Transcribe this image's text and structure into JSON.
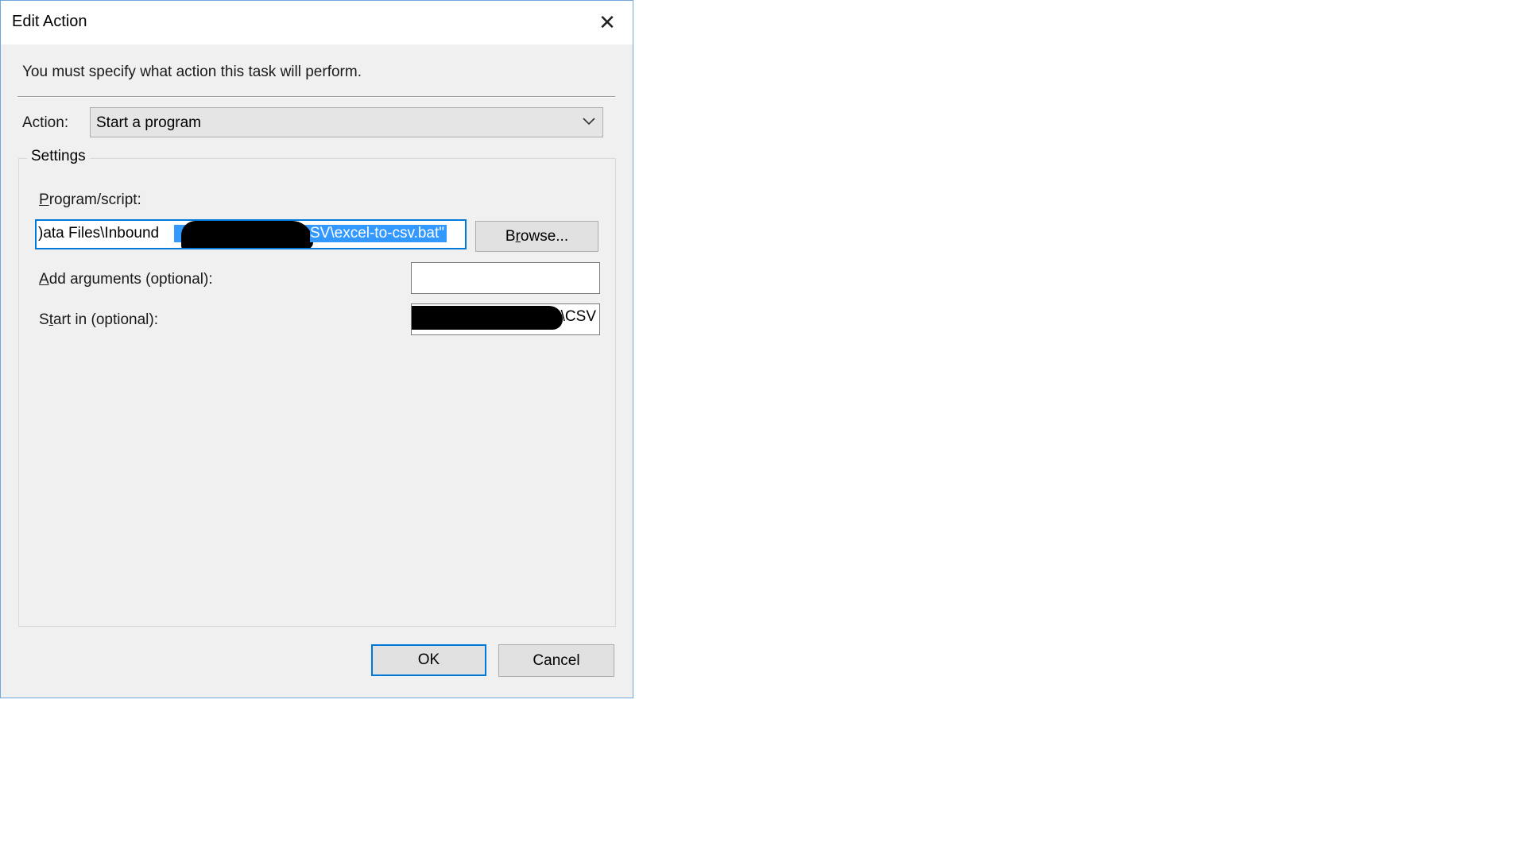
{
  "dialog": {
    "title": "Edit Action",
    "instruction": "You must specify what action this task will perform."
  },
  "action": {
    "label_key": "Action",
    "label_rest": ":",
    "selected": "Start a program"
  },
  "settings": {
    "legend": "Settings",
    "program": {
      "label_key": "P",
      "label_rest": "rogram/script:",
      "value_before": ")ata Files\\Inbound",
      "value_selected": "SV\\excel-to-csv.bat\""
    },
    "browse_button": {
      "key": "r",
      "pre": "B",
      "post": "owse..."
    },
    "arguments": {
      "label_key": "A",
      "label_rest": "dd arguments (optional):",
      "value": ""
    },
    "start_in": {
      "label_pre": "S",
      "label_key": "t",
      "label_rest": "art in (optional):",
      "value_visible": "ex\\CSV"
    }
  },
  "buttons": {
    "ok": "OK",
    "cancel": "Cancel"
  },
  "icons": {
    "close": "close-icon",
    "dropdown": "chevron-down-icon"
  },
  "colors": {
    "accent": "#0078d7",
    "selection": "#3399ff"
  }
}
